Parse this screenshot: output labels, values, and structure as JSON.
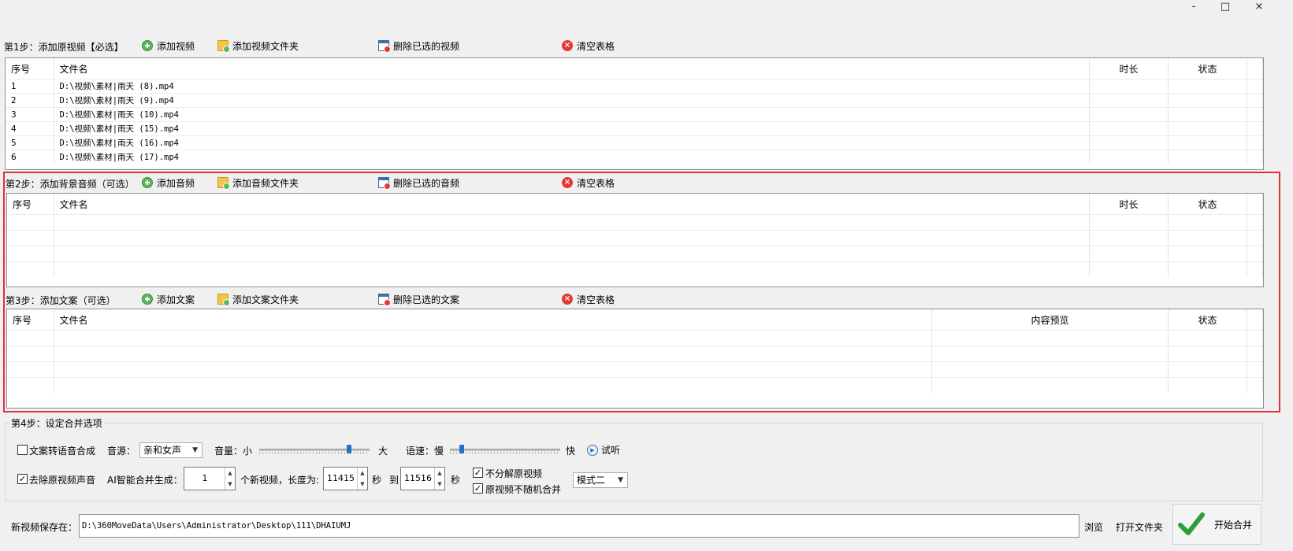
{
  "window": {
    "minimize": "-",
    "maximize": "□",
    "close": "×"
  },
  "step1": {
    "title": "第1步：添加原视频【必选】",
    "add": "添加视频",
    "add_folder": "添加视频文件夹",
    "delete": "删除已选的视频",
    "clear": "清空表格",
    "columns": {
      "index": "序号",
      "filename": "文件名",
      "duration": "时长",
      "status": "状态"
    },
    "rows": [
      {
        "index": "1",
        "file": "D:\\视频\\素材|雨天 (8).mp4"
      },
      {
        "index": "2",
        "file": "D:\\视频\\素材|雨天 (9).mp4"
      },
      {
        "index": "3",
        "file": "D:\\视频\\素材|雨天 (10).mp4"
      },
      {
        "index": "4",
        "file": "D:\\视频\\素材|雨天 (15).mp4"
      },
      {
        "index": "5",
        "file": "D:\\视频\\素材|雨天 (16).mp4"
      },
      {
        "index": "6",
        "file": "D:\\视频\\素材|雨天 (17).mp4"
      }
    ]
  },
  "step2": {
    "title": "第2步：添加背景音频（可选）",
    "add": "添加音频",
    "add_folder": "添加音频文件夹",
    "delete": "删除已选的音频",
    "clear": "清空表格",
    "columns": {
      "index": "序号",
      "filename": "文件名",
      "duration": "时长",
      "status": "状态"
    }
  },
  "step3": {
    "title": "第3步：添加文案（可选）",
    "add": "添加文案",
    "add_folder": "添加文案文件夹",
    "delete": "删除已选的文案",
    "clear": "清空表格",
    "columns": {
      "index": "序号",
      "filename": "文件名",
      "preview": "内容预览",
      "status": "状态"
    }
  },
  "step4": {
    "title": "第4步：设定合并选项",
    "tts_label": "文案转语音合成",
    "tts_checked": false,
    "voice_label": "音源：",
    "voice_value": "亲和女声",
    "volume_label": "音量：小",
    "volume_max": "大",
    "volume_level": 0.83,
    "speed_label": "语速：慢",
    "speed_max": "快",
    "speed_level": 0.09,
    "listen": "试听",
    "remove_audio_label": "去除原视频声音",
    "remove_audio_checked": true,
    "ai_label": "AI智能合并生成：",
    "count": "1",
    "count_suffix": "个新视频，长度为:",
    "len_min": "11415",
    "sec": "秒",
    "to": "到",
    "len_max": "11516",
    "no_split_label": "不分解原视频",
    "no_split_checked": true,
    "no_random_label": "原视频不随机合并",
    "no_random_checked": true,
    "mode_value": "模式二"
  },
  "output": {
    "label": "新视频保存在：",
    "path": "D:\\360MoveData\\Users\\Administrator\\Desktop\\111\\DHAIUMJ",
    "browse": "浏览",
    "open_folder": "打开文件夹",
    "start": "开始合并"
  },
  "colors": {
    "highlight": "#e0303b",
    "accent": "#1e73c8",
    "check": "#2e9e3a"
  }
}
